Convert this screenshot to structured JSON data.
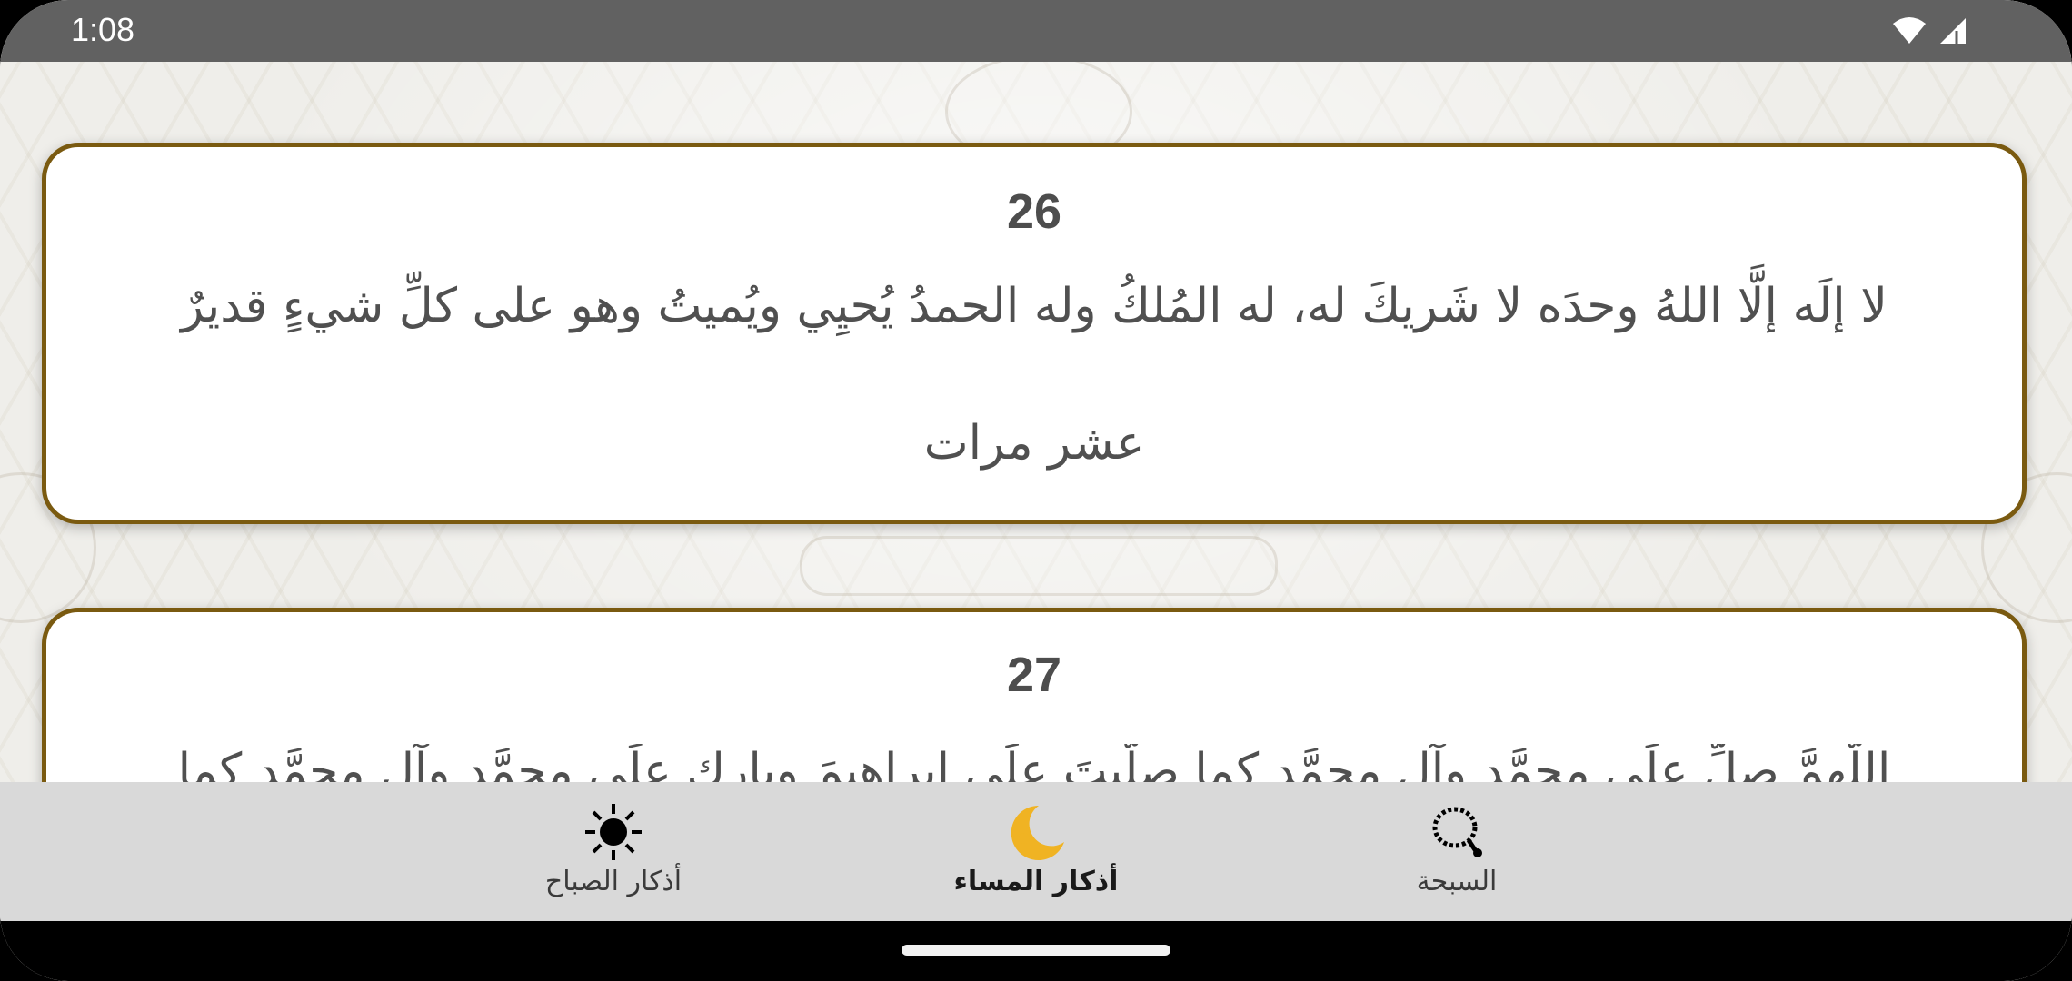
{
  "status_bar": {
    "time": "1:08",
    "icons": [
      "wifi-icon",
      "cellular-signal-icon"
    ]
  },
  "cards": [
    {
      "number": "26",
      "text": "لا إلَه إلَّا اللهُ وحدَه لا شَريكَ له، له المُلكُ وله الحمدُ يُحيِي ويُميتُ وهو على كلِّ شيءٍ قديرٌ",
      "note": "عشر مرات"
    },
    {
      "number": "27",
      "text": "اللَّهمَّ صلِّ علَى محمَّدٍ وآلِ محمَّدٍ كما صلَّيتَ علَى إبراهيمَ وبارِك علَى محمَّدٍ وآلِ محمَّدٍ كما"
    }
  ],
  "bottom_nav": {
    "items": [
      {
        "label": "أذكار الصباح",
        "icon": "sun-icon",
        "active": false
      },
      {
        "label": "أذكار المساء",
        "icon": "crescent-moon-icon",
        "active": true
      },
      {
        "label": "السبحة",
        "icon": "prayer-beads-icon",
        "active": false
      }
    ]
  },
  "colors": {
    "card_border": "#7a5a10",
    "status_bar": "#616161",
    "nav_background": "#d9d9d9",
    "moon_icon": "#f0b323"
  }
}
